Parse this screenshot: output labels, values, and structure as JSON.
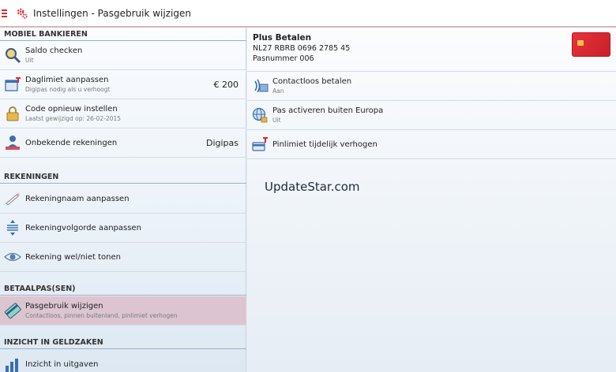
{
  "header": {
    "title": "Instellingen - Pasgebruik wijzigen"
  },
  "left": {
    "sections": [
      {
        "label": "MOBIEL BANKIEREN"
      },
      {
        "label": "REKENINGEN"
      },
      {
        "label": "BETAALPAS(SEN)"
      },
      {
        "label": "INZICHT IN GELDZAKEN"
      }
    ],
    "mobiel": [
      {
        "title": "Saldo checken",
        "sub": "Uit",
        "value": ""
      },
      {
        "title": "Daglimiet aanpassen",
        "sub": "Digipas nodig als u verhoogt",
        "value": "€ 200"
      },
      {
        "title": "Code opnieuw instellen",
        "sub": "Laatst gewijzigd op: 26-02-2015",
        "value": ""
      },
      {
        "title": "Onbekende rekeningen",
        "sub": "",
        "value": "Digipas"
      }
    ],
    "rekeningen": [
      {
        "title": "Rekeningnaam aanpassen"
      },
      {
        "title": "Rekeningvolgorde aanpassen"
      },
      {
        "title": "Rekening wel/niet tonen"
      }
    ],
    "betaalpas": [
      {
        "title": "Pasgebruik wijzigen",
        "sub": "Contactloos, pinnen buitenland, pinlimiet verhogen"
      }
    ],
    "inzicht": [
      {
        "title": "Inzicht in uitgaven"
      }
    ]
  },
  "right": {
    "card": {
      "title": "Plus Betalen",
      "iban": "NL27 RBRB 0696 2785 45",
      "pasnummer": "Pasnummer 006"
    },
    "items": [
      {
        "title": "Contactloos betalen",
        "sub": "Aan"
      },
      {
        "title": "Pas activeren buiten Europa",
        "sub": "Uit"
      },
      {
        "title": "Pinlimiet tijdelijk verhogen",
        "sub": ""
      }
    ],
    "watermark": "UpdateStar.com"
  },
  "colors": {
    "accent": "#e0252f",
    "selected": "#dcc5d1",
    "section_line": "#9fb0bf"
  },
  "icons": [
    "menu-icon",
    "gear-icon",
    "magnifier-icon",
    "calendar-limit-icon",
    "lock-icon",
    "person-icon",
    "pencil-icon",
    "reorder-icon",
    "eye-icon",
    "card-icon",
    "bar-chart-icon",
    "contactless-icon",
    "globe-lock-icon",
    "card-limit-icon"
  ]
}
